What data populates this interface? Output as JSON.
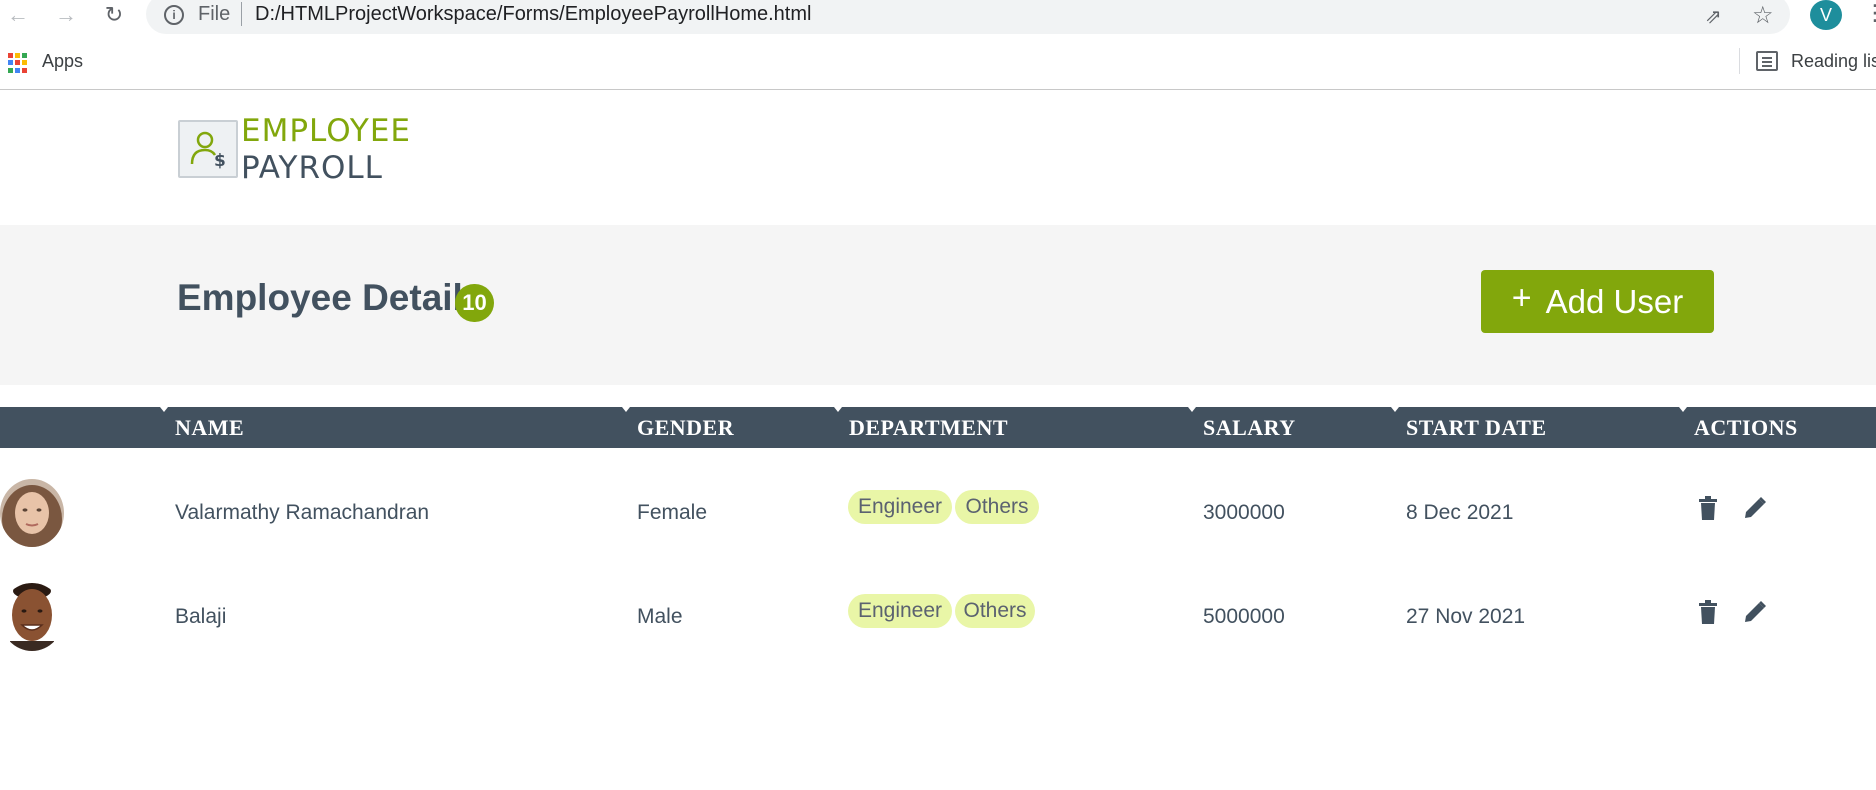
{
  "browser": {
    "file_label": "File",
    "url": "D:/HTMLProjectWorkspace/Forms/EmployeePayrollHome.html",
    "profile_initial": "V",
    "bookmarks": {
      "apps_label": "Apps",
      "reading_list_label": "Reading lis"
    }
  },
  "header": {
    "logo_line1": "EMPLOYEE",
    "logo_line2": "PAYROLL"
  },
  "banner": {
    "title": "Employee Details",
    "count": "10",
    "add_button_icon": "+",
    "add_button_label": "Add User"
  },
  "table": {
    "headers": [
      "NAME",
      "GENDER",
      "DEPARTMENT",
      "SALARY",
      "START DATE",
      "ACTIONS"
    ],
    "rows": [
      {
        "name": "Valarmathy Ramachandran",
        "gender": "Female",
        "departments": [
          "Engineer",
          "Others"
        ],
        "salary": "3000000",
        "start_date": "8 Dec 2021",
        "actions": [
          "delete-icon",
          "edit-icon"
        ]
      },
      {
        "name": "Balaji",
        "gender": "Male",
        "departments": [
          "Engineer",
          "Others"
        ],
        "salary": "5000000",
        "start_date": "27 Nov 2021",
        "actions": [
          "delete-icon",
          "edit-icon"
        ]
      }
    ]
  },
  "colors": {
    "accent_green": "#82a70c",
    "dark_slate": "#42515f",
    "chip_bg": "#e9f6a7",
    "banner_bg": "#f5f5f5"
  }
}
